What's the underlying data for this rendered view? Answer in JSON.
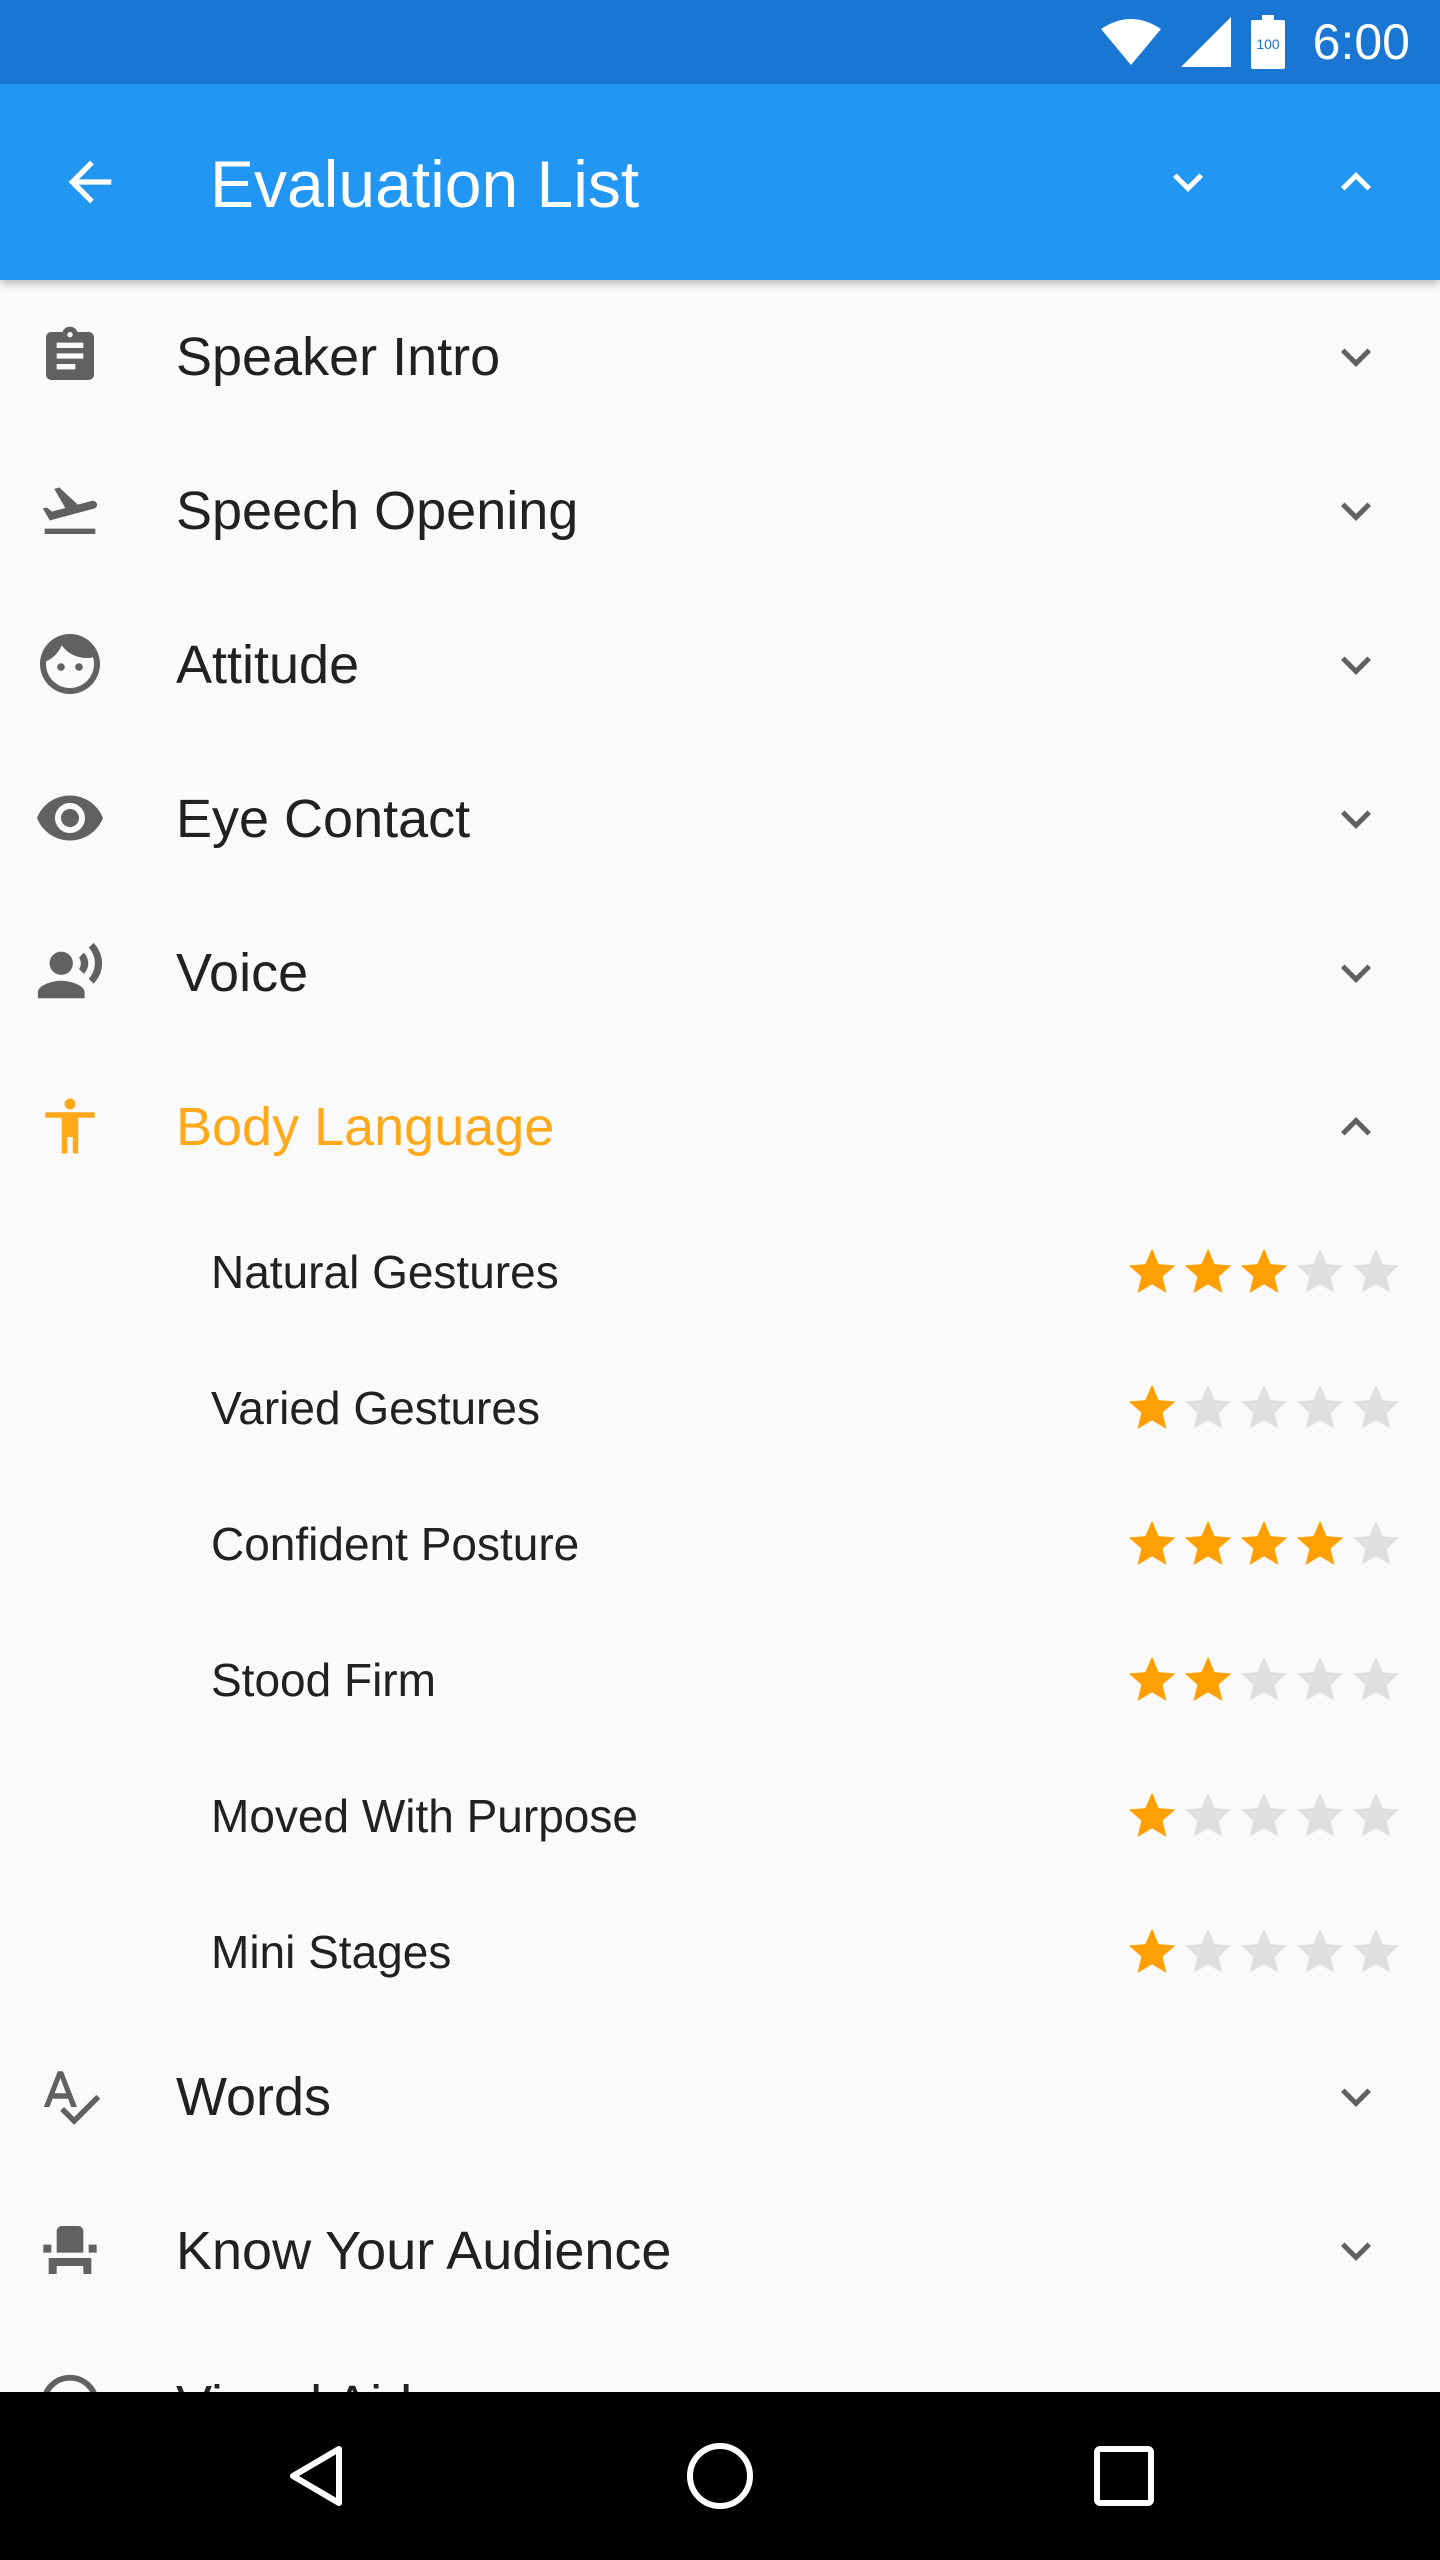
{
  "status_bar": {
    "time": "6:00",
    "icons": [
      "wifi-icon",
      "signal-icon",
      "battery-icon"
    ],
    "battery_label": "100"
  },
  "app_bar": {
    "title": "Evaluation List",
    "icons": [
      "back-arrow-icon",
      "chevron-down-icon",
      "chevron-up-icon"
    ]
  },
  "colors": {
    "app_bar": "#2196f3",
    "status_bar": "#1976d2",
    "accent": "#ffa81a",
    "star_filled": "#ffa000",
    "star_empty": "#e0e0e0",
    "icon_gray": "#616161"
  },
  "categories_before": [
    {
      "label": "Speaker Intro",
      "icon": "clipboard-icon"
    },
    {
      "label": "Speech Opening",
      "icon": "flight-takeoff-icon"
    },
    {
      "label": "Attitude",
      "icon": "face-icon"
    },
    {
      "label": "Eye Contact",
      "icon": "eye-icon"
    },
    {
      "label": "Voice",
      "icon": "record-voice-icon"
    }
  ],
  "expanded_category": {
    "label": "Body Language",
    "icon": "accessibility-icon",
    "items": [
      {
        "label": "Natural Gestures",
        "rating": 3,
        "max": 5
      },
      {
        "label": "Varied Gestures",
        "rating": 1,
        "max": 5
      },
      {
        "label": "Confident Posture",
        "rating": 4,
        "max": 5
      },
      {
        "label": "Stood Firm",
        "rating": 2,
        "max": 5
      },
      {
        "label": "Moved With Purpose",
        "rating": 1,
        "max": 5
      },
      {
        "label": "Mini Stages",
        "rating": 1,
        "max": 5
      }
    ]
  },
  "categories_after": [
    {
      "label": "Words",
      "icon": "spellcheck-icon"
    },
    {
      "label": "Know Your Audience",
      "icon": "event-seat-icon"
    },
    {
      "label": "Visual Aids",
      "icon": "visual-aids-icon"
    }
  ],
  "nav_bar": {
    "icons": [
      "nav-back-icon",
      "nav-home-icon",
      "nav-recents-icon"
    ]
  }
}
